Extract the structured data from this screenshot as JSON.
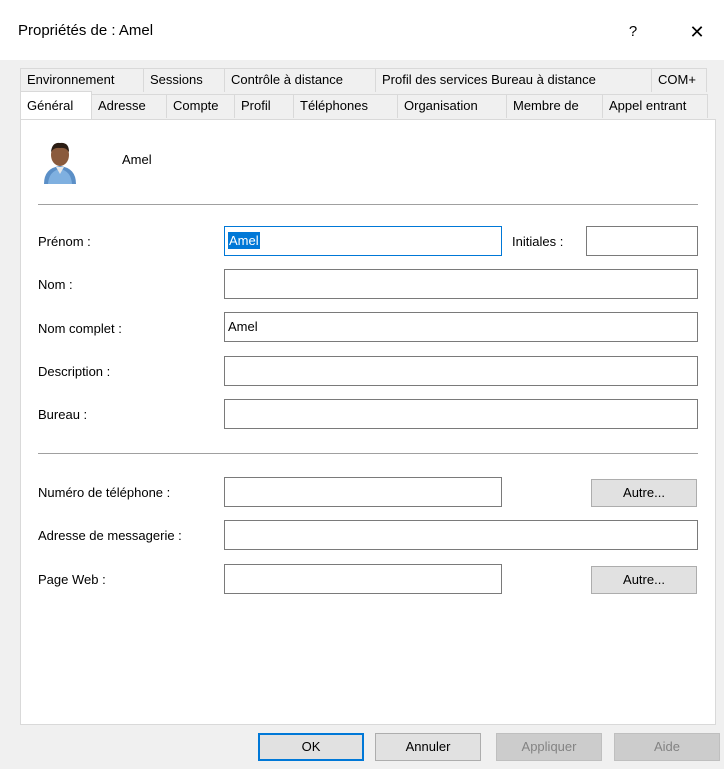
{
  "window": {
    "title": "Propriétés de : Amel",
    "help_label": "?",
    "close_label": "✕"
  },
  "tabs": {
    "row1": [
      "Environnement",
      "Sessions",
      "Contrôle à distance",
      "Profil des services Bureau à distance",
      "COM+"
    ],
    "row2": [
      "Général",
      "Adresse",
      "Compte",
      "Profil",
      "Téléphones",
      "Organisation",
      "Membre de",
      "Appel entrant"
    ],
    "active": "Général"
  },
  "user": {
    "display_name": "Amel",
    "icon": "user-avatar-icon"
  },
  "form": {
    "first_name_label": "Prénom :",
    "first_name_value": "Amel",
    "initials_label": "Initiales :",
    "initials_value": "",
    "last_name_label": "Nom :",
    "last_name_value": "",
    "full_name_label": "Nom complet :",
    "full_name_value": "Amel",
    "description_label": "Description :",
    "description_value": "",
    "office_label": "Bureau :",
    "office_value": "",
    "phone_label": "Numéro de téléphone :",
    "phone_value": "",
    "phone_other_label": "Autre...",
    "email_label": "Adresse de messagerie :",
    "email_value": "",
    "web_label": "Page Web :",
    "web_value": "",
    "web_other_label": "Autre..."
  },
  "footer": {
    "ok_label": "OK",
    "cancel_label": "Annuler",
    "apply_label": "Appliquer",
    "help_label": "Aide"
  },
  "colors": {
    "accent": "#0078d7",
    "dialog_bg": "#f0f0f0"
  }
}
